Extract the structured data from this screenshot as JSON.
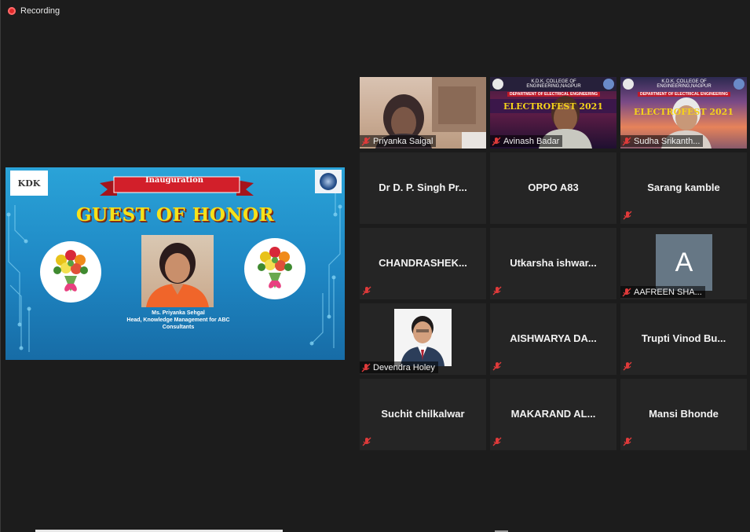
{
  "recording": {
    "label": "Recording",
    "icon": "record-dot-icon",
    "color": "#e02828"
  },
  "shared_screen": {
    "logo_left": "KDK",
    "ribbon_text": "Inauguration",
    "headline": "GUEST OF HONOR",
    "speaker_name": "Ms. Priyanka Sehgal",
    "speaker_title": "Head, Knowledge Management for ABC",
    "speaker_org": "Consultants",
    "colors": {
      "background": "#1e86c3",
      "headline": "#f5e21a",
      "ribbon": "#d21f2a"
    }
  },
  "video_tiles": [
    {
      "name": "Priyanka Saigal",
      "muted": true
    },
    {
      "name": "Avinash Badar",
      "muted": true,
      "banner_college": "K.D.K. COLLEGE OF ENGINEERING,NAGPUR",
      "banner_dept": "DEPARTMENT OF ELECTRICAL ENGINEERING",
      "banner_event": "ELECTROFEST 2021"
    },
    {
      "name": "Sudha Srikanth...",
      "muted": true,
      "banner_college": "K.D.K. COLLEGE OF ENGINEERING,NAGPUR",
      "banner_dept": "DEPARTMENT OF ELECTRICAL ENGINEERING",
      "banner_event": "ELECTROFEST 2021"
    }
  ],
  "name_tiles": [
    {
      "name": "Dr D. P. Singh Pr...",
      "muted": false
    },
    {
      "name": "OPPO A83",
      "muted": false
    },
    {
      "name": "Sarang kamble",
      "muted": true
    },
    {
      "name": "CHANDRASHEK...",
      "muted": true
    },
    {
      "name": "Utkarsha  ishwar...",
      "muted": true
    },
    {
      "name": "AISHWARYA  DA...",
      "muted": true
    },
    {
      "name": "Trupti Vinod Bu...",
      "muted": true
    },
    {
      "name": "Suchit chilkalwar",
      "muted": true
    },
    {
      "name": "MAKARAND AL...",
      "muted": true
    },
    {
      "name": "Mansi Bhonde",
      "muted": true
    }
  ],
  "avatar_tiles": [
    {
      "name": "AAFREEN SHA...",
      "initial": "A",
      "muted": true,
      "avatar_color": "#667785"
    },
    {
      "name": "Devendra Holey",
      "muted": true
    }
  ],
  "icons": {
    "muted_mic": "mic-muted-icon"
  }
}
